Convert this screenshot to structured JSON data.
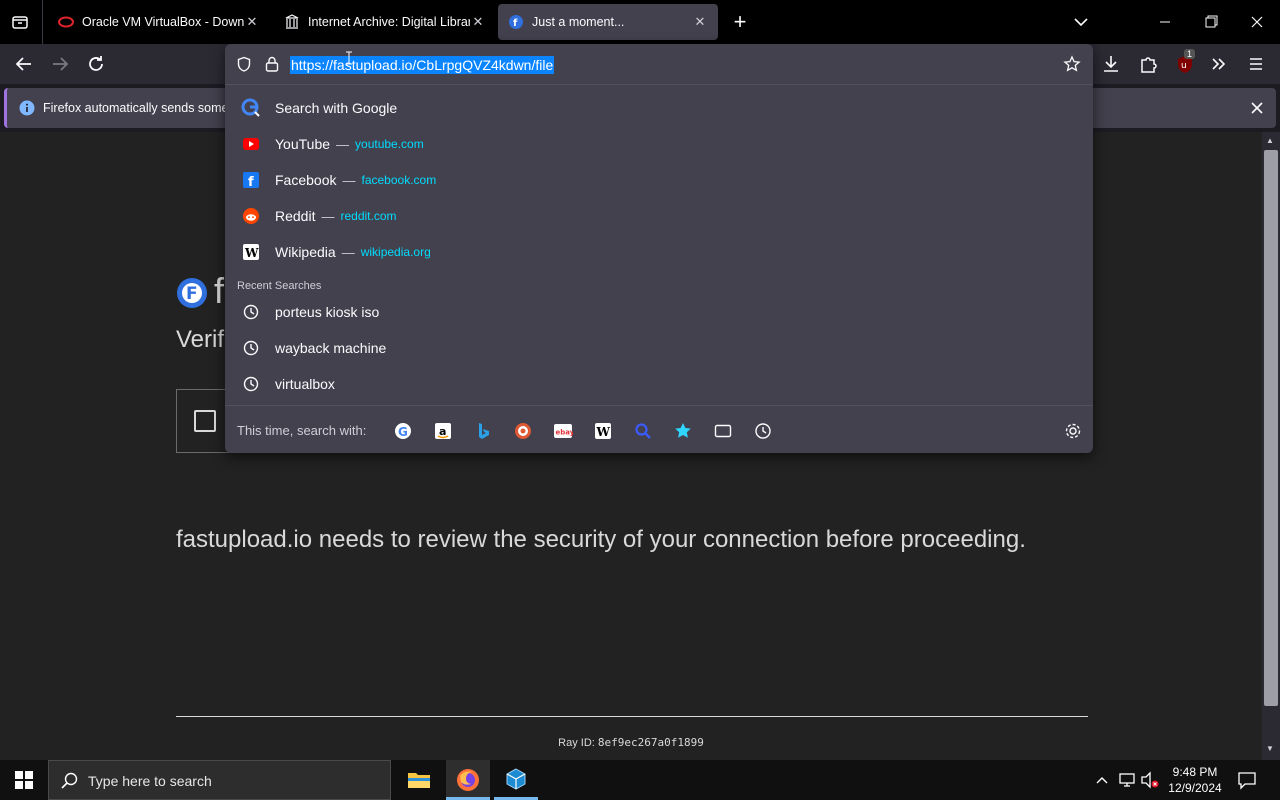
{
  "tabs": [
    {
      "title": "Oracle VM VirtualBox - Downlo"
    },
    {
      "title": "Internet Archive: Digital Library"
    },
    {
      "title": "Just a moment..."
    }
  ],
  "addressbar": {
    "url": "https://fastupload.io/CbLrpgQVZ4kdwn/file"
  },
  "ublock_badge": "1",
  "notification": {
    "text": "Firefox automatically sends some c"
  },
  "suggestions": {
    "search_google": "Search with Google",
    "items": [
      {
        "title": "YouTube",
        "url": "youtube.com"
      },
      {
        "title": "Facebook",
        "url": "facebook.com"
      },
      {
        "title": "Reddit",
        "url": "reddit.com"
      },
      {
        "title": "Wikipedia",
        "url": "wikipedia.org"
      }
    ],
    "dash": "—",
    "recent_heading": "Recent Searches",
    "recent": [
      "porteus kiosk iso",
      "wayback machine",
      "virtualbox"
    ],
    "search_with_label": "This time, search with:"
  },
  "page": {
    "logo_letter": "f",
    "verify_partial": "Verif",
    "security_msg": "fastupload.io needs to review the security of your connection before proceeding.",
    "ray_label": "Ray ID:",
    "ray_id": "8ef9ec267a0f1899"
  },
  "taskbar": {
    "search_placeholder": "Type here to search",
    "time": "9:48 PM",
    "date": "12/9/2024"
  },
  "colors": {
    "accent_link": "#00ddff",
    "highlight": "#0a84ff",
    "panel": "#42414d"
  }
}
